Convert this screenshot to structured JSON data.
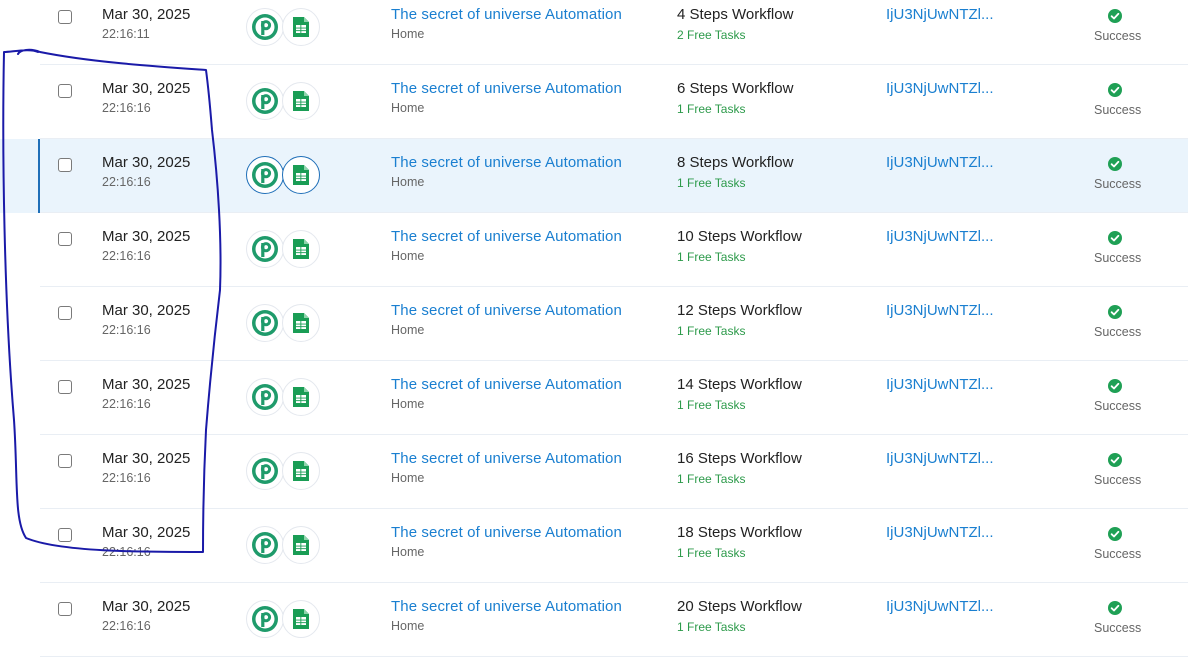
{
  "colors": {
    "link": "#1a7fd0",
    "free_tasks": "#2c9a4a",
    "success": "#1fa055",
    "selected_row_bg": "#eaf4fc",
    "annotation_ink": "#1a1aa8"
  },
  "icons": {
    "app1": "pabbly-p-icon",
    "app2": "google-sheets-icon",
    "status": "check-circle-icon"
  },
  "rows": [
    {
      "date": "Mar 30, 2025",
      "time": "22:16:11",
      "name": "The secret of universe Automation",
      "sub": "Home",
      "steps": "4 Steps Workflow",
      "tasks": "2 Free Tasks",
      "hash": "IjU3NjUwNTZl...",
      "status": "Success",
      "selected": false
    },
    {
      "date": "Mar 30, 2025",
      "time": "22:16:16",
      "name": "The secret of universe Automation",
      "sub": "Home",
      "steps": "6 Steps Workflow",
      "tasks": "1 Free Tasks",
      "hash": "IjU3NjUwNTZl...",
      "status": "Success",
      "selected": false
    },
    {
      "date": "Mar 30, 2025",
      "time": "22:16:16",
      "name": "The secret of universe Automation",
      "sub": "Home",
      "steps": "8 Steps Workflow",
      "tasks": "1 Free Tasks",
      "hash": "IjU3NjUwNTZl...",
      "status": "Success",
      "selected": true
    },
    {
      "date": "Mar 30, 2025",
      "time": "22:16:16",
      "name": "The secret of universe Automation",
      "sub": "Home",
      "steps": "10 Steps Workflow",
      "tasks": "1 Free Tasks",
      "hash": "IjU3NjUwNTZl...",
      "status": "Success",
      "selected": false
    },
    {
      "date": "Mar 30, 2025",
      "time": "22:16:16",
      "name": "The secret of universe Automation",
      "sub": "Home",
      "steps": "12 Steps Workflow",
      "tasks": "1 Free Tasks",
      "hash": "IjU3NjUwNTZl...",
      "status": "Success",
      "selected": false
    },
    {
      "date": "Mar 30, 2025",
      "time": "22:16:16",
      "name": "The secret of universe Automation",
      "sub": "Home",
      "steps": "14 Steps Workflow",
      "tasks": "1 Free Tasks",
      "hash": "IjU3NjUwNTZl...",
      "status": "Success",
      "selected": false
    },
    {
      "date": "Mar 30, 2025",
      "time": "22:16:16",
      "name": "The secret of universe Automation",
      "sub": "Home",
      "steps": "16 Steps Workflow",
      "tasks": "1 Free Tasks",
      "hash": "IjU3NjUwNTZl...",
      "status": "Success",
      "selected": false
    },
    {
      "date": "Mar 30, 2025",
      "time": "22:16:16",
      "name": "The secret of universe Automation",
      "sub": "Home",
      "steps": "18 Steps Workflow",
      "tasks": "1 Free Tasks",
      "hash": "IjU3NjUwNTZl...",
      "status": "Success",
      "selected": false
    },
    {
      "date": "Mar 30, 2025",
      "time": "22:16:16",
      "name": "The secret of universe Automation",
      "sub": "Home",
      "steps": "20 Steps Workflow",
      "tasks": "1 Free Tasks",
      "hash": "IjU3NjUwNTZl...",
      "status": "Success",
      "selected": false
    }
  ]
}
